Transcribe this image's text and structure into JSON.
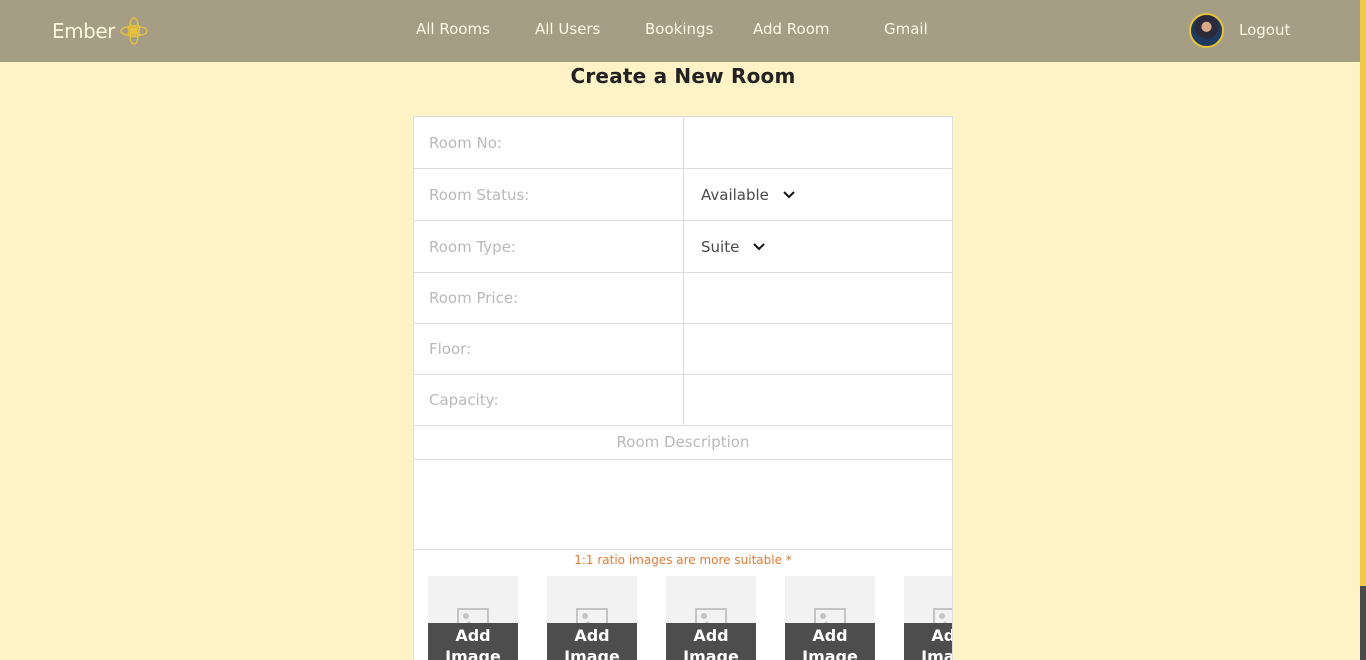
{
  "nav": {
    "brand": "Ember",
    "brand_icon": "lotus-icon",
    "links": [
      "All Rooms",
      "All Users",
      "Bookings",
      "Add Room",
      "Gmail"
    ],
    "logout": "Logout",
    "colors": {
      "bar": "#a59e85",
      "text": "#fdf6e3",
      "accent": "#e8c33a"
    }
  },
  "page": {
    "title": "Create a New Room",
    "background": "#fef3c7"
  },
  "form": {
    "room_no": {
      "label": "Room No:",
      "value": ""
    },
    "room_status": {
      "label": "Room Status:",
      "selected": "Available"
    },
    "room_type": {
      "label": "Room Type:",
      "selected": "Suite"
    },
    "room_price": {
      "label": "Room Price:",
      "value": ""
    },
    "floor": {
      "label": "Floor:",
      "value": ""
    },
    "capacity": {
      "label": "Capacity:",
      "value": ""
    },
    "description": {
      "label": "Room Description",
      "value": ""
    },
    "image_hint": "1:1 ratio images are more suitable *",
    "image_button": "Add Image",
    "image_slots": 5
  }
}
